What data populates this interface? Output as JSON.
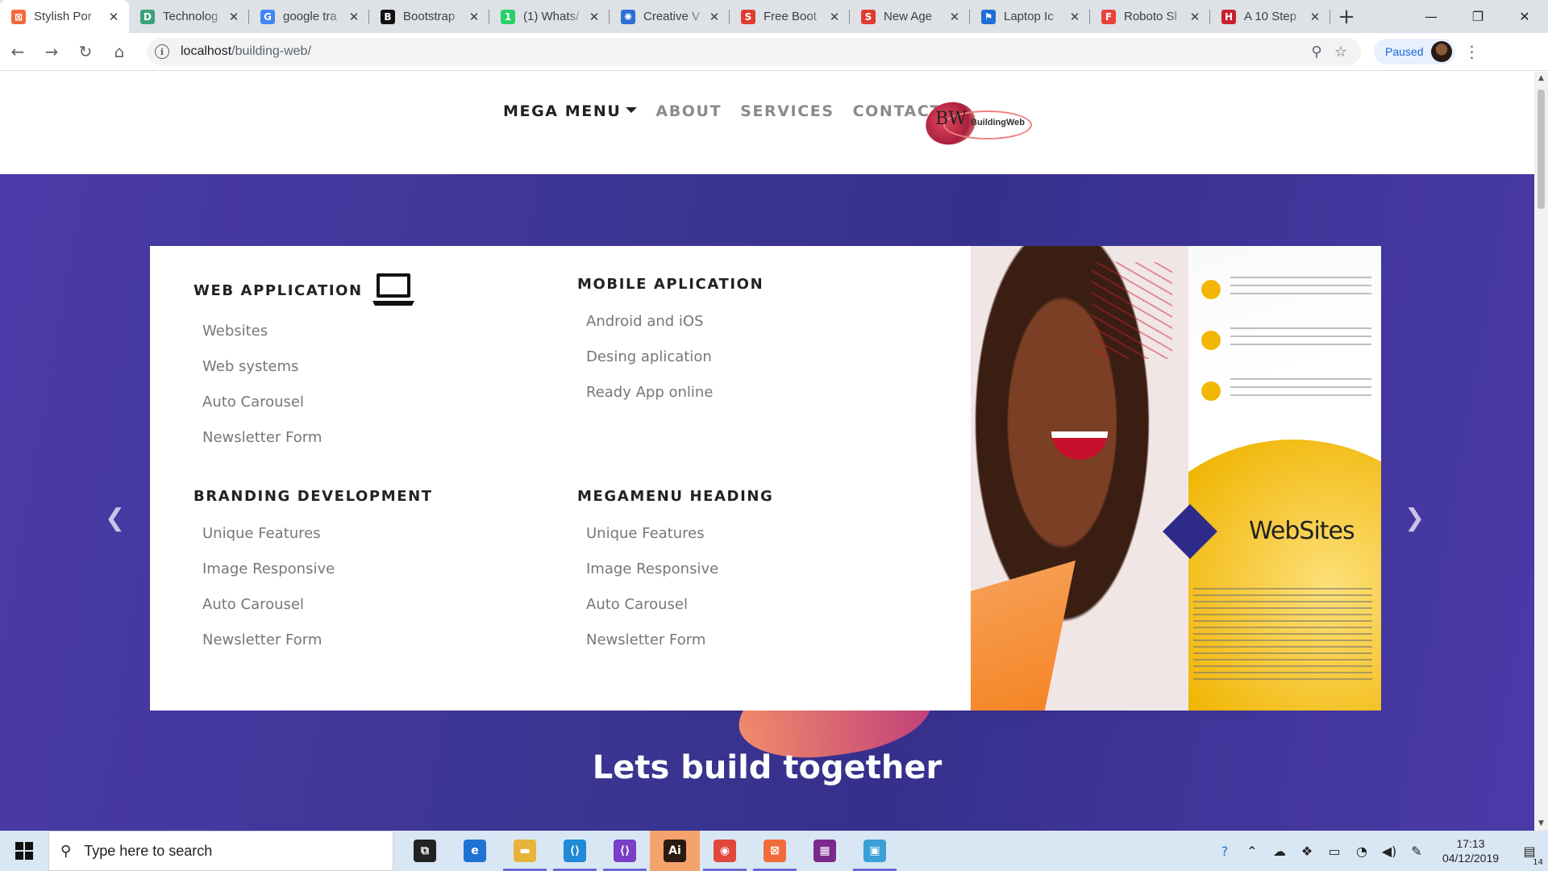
{
  "browser": {
    "tabs": [
      {
        "title": "Stylish Por",
        "icon": "xampp-icon",
        "icon_char": "⊠",
        "color": "#f26b3a",
        "active": true
      },
      {
        "title": "Technolog",
        "icon": "document-icon",
        "icon_char": "D",
        "color": "#3aa37a",
        "active": false
      },
      {
        "title": "google tra",
        "icon": "google-icon",
        "icon_char": "G",
        "color": "#4285f4",
        "active": false
      },
      {
        "title": "Bootstrap",
        "icon": "bootstrap-icon",
        "icon_char": "B",
        "color": "#111111",
        "active": false
      },
      {
        "title": "(1) Whats/",
        "icon": "whatsapp-icon",
        "icon_char": "1",
        "color": "#25d366",
        "active": false
      },
      {
        "title": "Creative V",
        "icon": "gear-icon",
        "icon_char": "✺",
        "color": "#2c6fd6",
        "active": false
      },
      {
        "title": "Free Boot",
        "icon": "s-icon",
        "icon_char": "S",
        "color": "#e03c31",
        "active": false
      },
      {
        "title": "New Age",
        "icon": "s-icon",
        "icon_char": "S",
        "color": "#e03c31",
        "active": false
      },
      {
        "title": "Laptop Ic",
        "icon": "flag-icon",
        "icon_char": "⚑",
        "color": "#1f6fd6",
        "active": false
      },
      {
        "title": "Roboto Sl",
        "icon": "font-icon",
        "icon_char": "F",
        "color": "#e8433a",
        "active": false
      },
      {
        "title": "A 10 Step",
        "icon": "shield-icon",
        "icon_char": "H",
        "color": "#c8202f",
        "active": false
      }
    ],
    "url_host": "localhost",
    "url_path": "/building-web/",
    "profile_label": "Paused"
  },
  "nav": {
    "items": [
      "MEGA MENU",
      "ABOUT",
      "SERVICES",
      "CONTACT"
    ],
    "logo_mark": "BW",
    "logo_text": "BuildingWeb"
  },
  "mega_menu": {
    "col1": {
      "heading": "WEB APPLICATION",
      "items": [
        "Websites",
        "Web systems",
        "Auto Carousel",
        "Newsletter Form"
      ]
    },
    "col2": {
      "heading": "MOBILE APLICATION",
      "items": [
        "Android and iOS",
        "Desing aplication",
        "Ready App online"
      ]
    },
    "col3": {
      "heading": "BRANDING DEVELOPMENT",
      "items": [
        "Unique Features",
        "Image Responsive",
        "Auto Carousel",
        "Newsletter Form"
      ]
    },
    "col4": {
      "heading": "MEGAMENU HEADING",
      "items": [
        "Unique Features",
        "Image Responsive",
        "Auto Carousel",
        "Newsletter Form"
      ]
    },
    "promo_title": "WebSites"
  },
  "hero": {
    "title": "Lets build together",
    "dots_count": 3,
    "accent_color": "#3fd0c4"
  },
  "taskbar": {
    "search_placeholder": "Type here to search",
    "apps": [
      {
        "name": "task-view-icon",
        "char": "⧉",
        "color": "#222222",
        "running": false,
        "active": false
      },
      {
        "name": "edge-icon",
        "char": "e",
        "color": "#1e72d6",
        "running": false,
        "active": false
      },
      {
        "name": "file-explorer-icon",
        "char": "▬",
        "color": "#e8b33a",
        "running": true,
        "active": false
      },
      {
        "name": "vscode-icon",
        "char": "⟨⟩",
        "color": "#1f8ad6",
        "running": true,
        "active": false
      },
      {
        "name": "visual-studio-icon",
        "char": "⟨⟩",
        "color": "#7a3fc6",
        "running": true,
        "active": false
      },
      {
        "name": "illustrator-icon",
        "char": "Ai",
        "color": "#2b1a0f",
        "running": false,
        "active": true
      },
      {
        "name": "chrome-icon",
        "char": "◉",
        "color": "#e0483c",
        "running": true,
        "active": false
      },
      {
        "name": "xampp-icon",
        "char": "⊠",
        "color": "#f26b3a",
        "running": true,
        "active": false
      },
      {
        "name": "winrar-icon",
        "char": "▦",
        "color": "#7a2a8a",
        "running": false,
        "active": false
      },
      {
        "name": "remote-desktop-icon",
        "char": "▣",
        "color": "#3aa0d6",
        "running": true,
        "active": false
      }
    ],
    "time": "17:13",
    "date": "04/12/2019",
    "notification_count": "14"
  }
}
